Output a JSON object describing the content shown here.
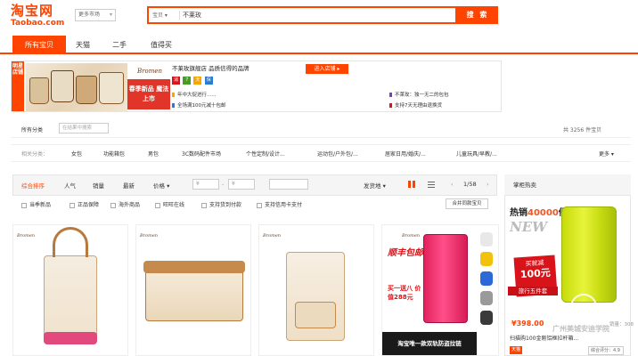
{
  "header": {
    "logo_cn": "淘宝网",
    "logo_en": "Taobao.com",
    "market": "更多市场",
    "search_scope": "宝贝",
    "search_value": "不莱玫",
    "search_button": "搜 索"
  },
  "tabs": [
    {
      "label": "所有宝贝",
      "active": true
    },
    {
      "label": "天猫",
      "active": false
    },
    {
      "label": "二手",
      "active": false
    },
    {
      "label": "值得买",
      "active": false
    }
  ],
  "banner": {
    "side_label": "明星店铺",
    "brand_logo": "Bromen",
    "promo": "春季新品 魔法上市",
    "title": "不莱玫旗舰店 品质信得的品牌",
    "enter": "进入店铺 ▸",
    "tags": [
      "消",
      "7",
      "天",
      "保"
    ],
    "lines": [
      {
        "text": "年中大促进行......",
        "color": "#f7a600"
      },
      {
        "text": "全场满100元减十包邮",
        "color": "#2a7bd1"
      },
      {
        "text": "不莱玫：独一无二的包包",
        "color": "#7a3fb0"
      },
      {
        "text": "支持7天无理由退换货",
        "color": "#d8141a"
      }
    ]
  },
  "filter": {
    "all_categories": "所有分类",
    "in_result_placeholder": "在结果中搜索",
    "result_count": "共 3256 件宝贝",
    "categories_label": "相关分类：",
    "categories": [
      "女包",
      "功能箱包",
      "男包",
      "3C数码配件市场",
      "个性定制/设计...",
      "运动包/户外包/...",
      "居家日用/婚庆/...",
      "儿童玩具/早教/..."
    ],
    "more": "更多 ▾"
  },
  "sort": {
    "items": [
      {
        "label": "综合排序",
        "active": true
      },
      {
        "label": "人气",
        "active": false
      },
      {
        "label": "销量",
        "active": false
      },
      {
        "label": "最新",
        "active": false
      },
      {
        "label": "价格 ▾",
        "active": false
      }
    ],
    "price_min": "¥",
    "price_max": "¥",
    "ship_from": "发货地 ▾",
    "page": "1/58",
    "checks": [
      "当季新品",
      "正品保障",
      "海外商品",
      "旺旺在线",
      "支持货到付款",
      "支持信用卡支付"
    ],
    "merge_button": "合并同款宝贝"
  },
  "cards": [
    {
      "brand": "Bromen"
    },
    {
      "brand": "Bromen"
    },
    {
      "brand": "Bromen"
    },
    {
      "brand": "Bromen",
      "promo_line1": "顺丰包邮",
      "promo_line2": "买一送八 价值288元",
      "promo_line3": "淘宝唯一款双轨防盗拉链"
    }
  ],
  "sidebar": {
    "title": "掌柜热卖",
    "ad_title_pre": "热销",
    "ad_title_num": "40000",
    "ad_title_post": "件",
    "ad_new": "NEW",
    "ad_badge_line1": "买就减",
    "ad_badge_amount": "100元",
    "ad_strip": "旅行五件套",
    "price": "¥398.00",
    "sold": "销量：308",
    "desc": "扫描购100金刚铝框拉杆箱...",
    "shop_badge": "天猫",
    "rating": "综合评分：4.9 ▾",
    "watermark": "广州美城安迪学院"
  },
  "colors": {
    "accent": "#ff4400",
    "promo_red": "#d8141a",
    "luggage_yellow": "#d6e81a"
  }
}
